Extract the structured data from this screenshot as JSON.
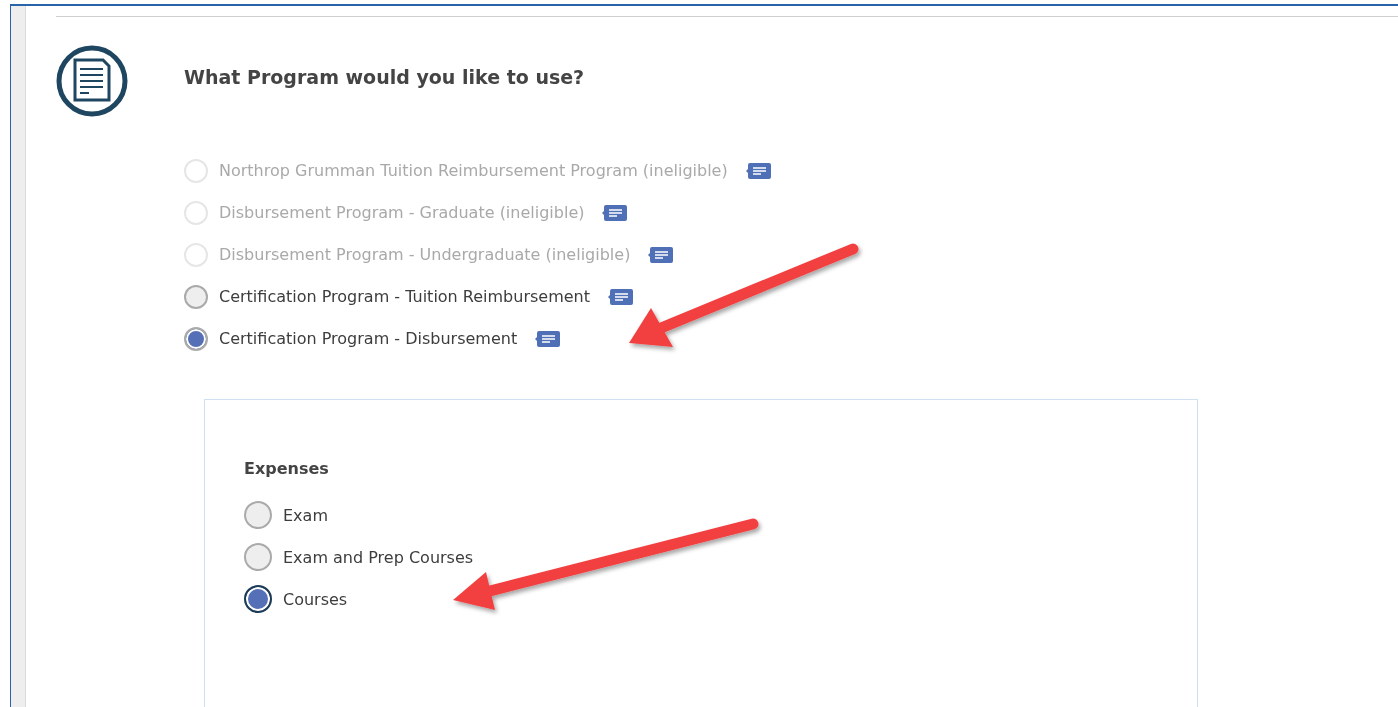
{
  "question": "What Program would you like to use?",
  "programs": [
    {
      "label": "Northrop Grumman Tuition Reimbursement Program (ineligible)",
      "disabled": true,
      "selected": false
    },
    {
      "label": "Disbursement Program - Graduate (ineligible)",
      "disabled": true,
      "selected": false
    },
    {
      "label": "Disbursement Program - Undergraduate (ineligible)",
      "disabled": true,
      "selected": false
    },
    {
      "label": "Certification Program - Tuition Reimbursement",
      "disabled": false,
      "selected": false
    },
    {
      "label": "Certification Program - Disbursement",
      "disabled": false,
      "selected": true
    }
  ],
  "expenses": {
    "title": "Expenses",
    "options": [
      {
        "label": "Exam",
        "selected": false
      },
      {
        "label": "Exam and Prep Courses",
        "selected": false
      },
      {
        "label": "Courses",
        "selected": true
      }
    ]
  }
}
